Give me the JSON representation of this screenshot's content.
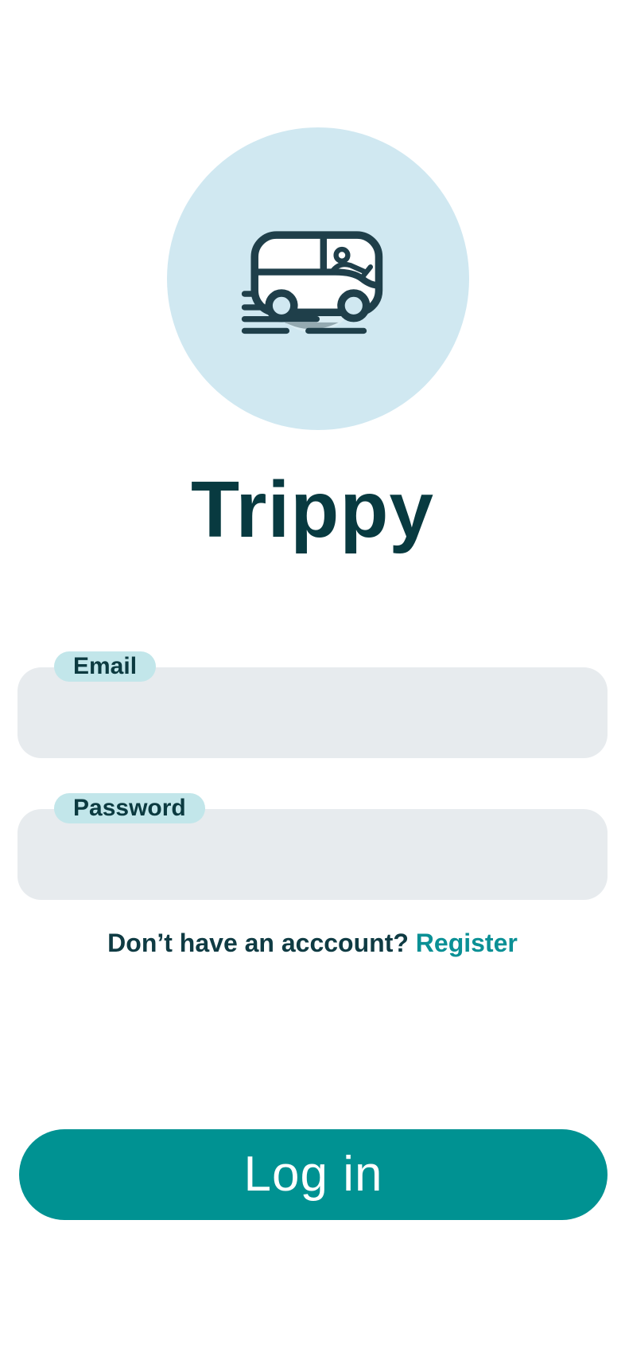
{
  "app": {
    "title": "Trippy",
    "logo_icon": "van-icon"
  },
  "form": {
    "email": {
      "label": "Email",
      "value": "",
      "placeholder": ""
    },
    "password": {
      "label": "Password",
      "value": "",
      "placeholder": ""
    }
  },
  "register": {
    "prompt": "Don’t have an acccount?",
    "link_label": "Register"
  },
  "login": {
    "label": "Log in"
  },
  "colors": {
    "primary": "#009292",
    "link": "#0a9095",
    "text_dark": "#083a40",
    "logo_bg": "#d0e8f1",
    "input_bg": "#e7ebee",
    "tag_bg": "#c2e6ea"
  }
}
